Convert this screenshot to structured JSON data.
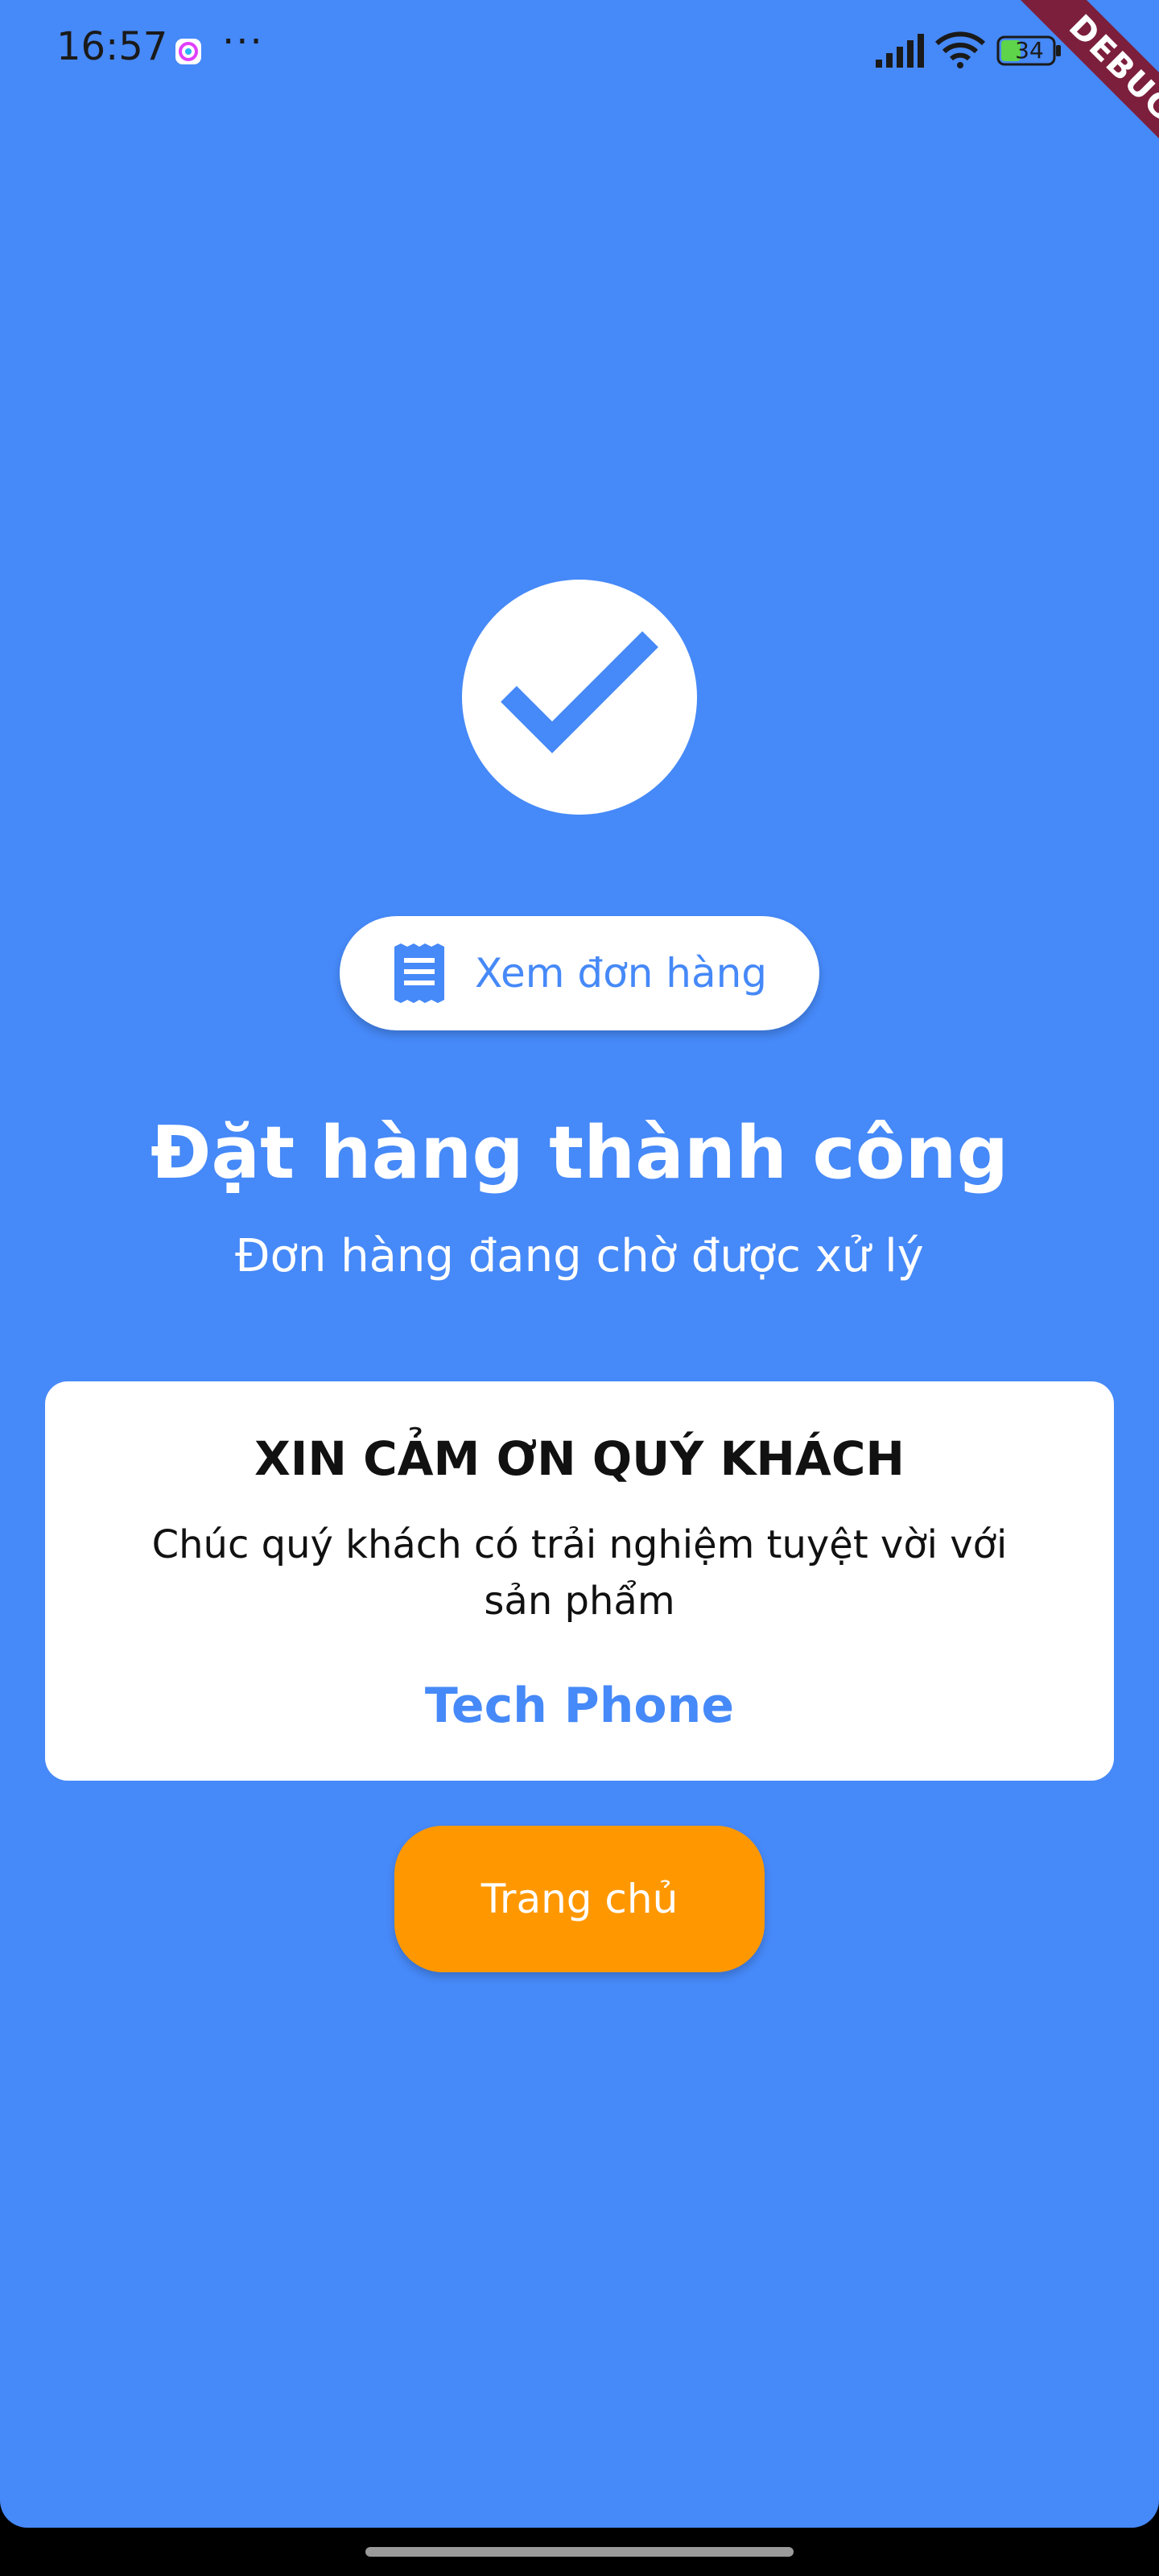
{
  "status_bar": {
    "time": "16:57",
    "more": "···",
    "battery": "34",
    "debug_label": "DEBUG"
  },
  "order_success": {
    "view_order_label": "Xem đơn hàng",
    "title": "Đặt hàng thành công",
    "subtitle": "Đơn hàng đang chờ được xử lý"
  },
  "thanks_card": {
    "heading": "XIN CẢM ƠN QUÝ KHÁCH",
    "message": "Chúc quý khách có trải nghiệm tuyệt vời với sản phẩm",
    "brand": "Tech Phone"
  },
  "home_button": {
    "label": "Trang chủ"
  },
  "colors": {
    "background": "#4689F8",
    "accent": "#FF9800",
    "card": "#FFFFFF",
    "debug_ribbon": "#7B1F3D"
  },
  "icons": {
    "check": "check-icon",
    "receipt": "receipt-icon",
    "signal": "signal-icon",
    "wifi": "wifi-icon",
    "battery": "battery-icon",
    "notification": "notification-app-icon"
  }
}
